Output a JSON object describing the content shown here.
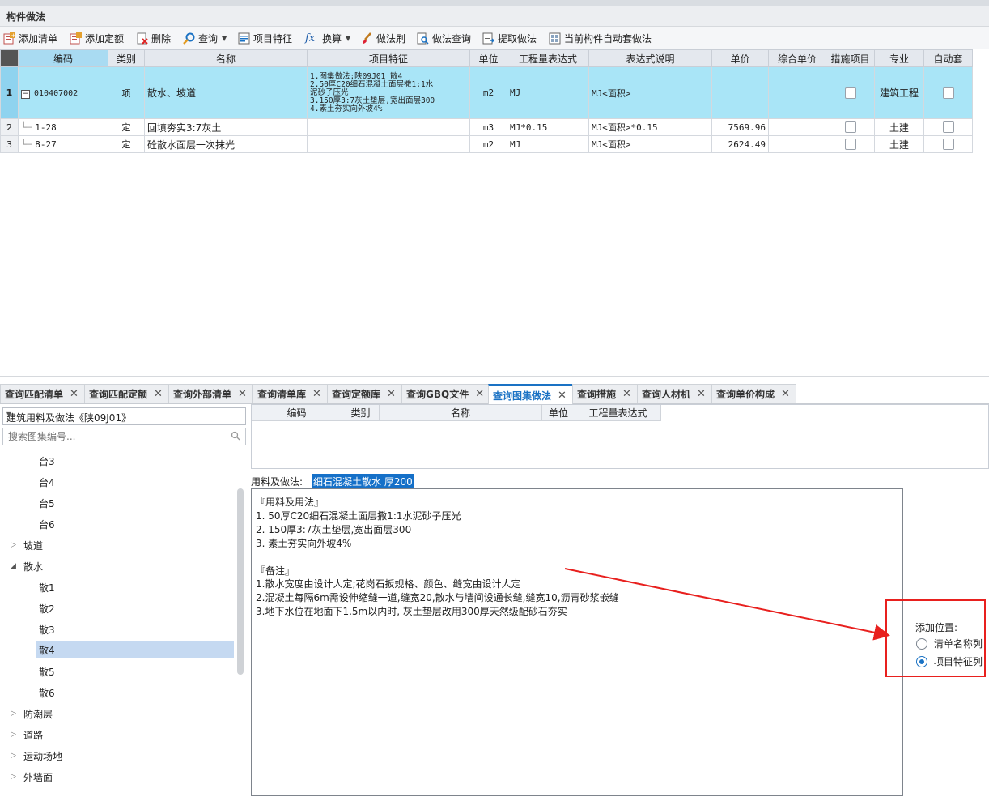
{
  "panel_title": "构件做法",
  "toolbar": {
    "add_list": "添加清单",
    "add_quota": "添加定额",
    "delete": "删除",
    "query": "查询",
    "item_feature": "项目特征",
    "convert": "换算",
    "method_brush": "做法刷",
    "method_query": "做法查询",
    "extract_method": "提取做法",
    "auto_apply": "当前构件自动套做法"
  },
  "grid": {
    "headers": [
      "编码",
      "类别",
      "名称",
      "项目特征",
      "单位",
      "工程量表达式",
      "表达式说明",
      "单价",
      "综合单价",
      "措施项目",
      "专业",
      "自动套"
    ],
    "rows": [
      {
        "num": "1",
        "tree": "−",
        "code": "010407002",
        "type": "项",
        "name": "散水、坡道",
        "feature": [
          "1.图集做法:陕09J01 散4",
          "2.50厚C20细石混凝土面层撒1:1水",
          "泥砂子压光",
          "3.150厚3:7灰土垫层,宽出面层300",
          "4.素土夯实向外坡4%"
        ],
        "unit": "m2",
        "expr": "MJ",
        "expr_desc": "MJ<面积>",
        "price": "",
        "comp_price": "",
        "measure": false,
        "specialty": "建筑工程",
        "auto": false
      },
      {
        "num": "2",
        "tree": "",
        "code": "1-28",
        "type": "定",
        "name": "回填夯实3:7灰土",
        "feature": [],
        "unit": "m3",
        "expr": "MJ*0.15",
        "expr_desc": "MJ<面积>*0.15",
        "price": "7569.96",
        "comp_price": "",
        "measure": false,
        "specialty": "土建",
        "auto": false
      },
      {
        "num": "3",
        "tree": "",
        "code": "8-27",
        "type": "定",
        "name": "砼散水面层一次抹光",
        "feature": [],
        "unit": "m2",
        "expr": "MJ",
        "expr_desc": "MJ<面积>",
        "price": "2624.49",
        "comp_price": "",
        "measure": false,
        "specialty": "土建",
        "auto": false
      }
    ]
  },
  "tabs": [
    "查询匹配清单",
    "查询匹配定额",
    "查询外部清单",
    "查询清单库",
    "查询定额库",
    "查询GBQ文件",
    "查询图集做法",
    "查询措施",
    "查询人材机",
    "查询单价构成"
  ],
  "active_tab": "查询图集做法",
  "left": {
    "combo_value": "建筑用料及做法《陕09J01》",
    "search_placeholder": "搜索图集编号...",
    "tree": [
      {
        "label": "台3",
        "level": 2,
        "arrow": ""
      },
      {
        "label": "台4",
        "level": 2,
        "arrow": ""
      },
      {
        "label": "台5",
        "level": 2,
        "arrow": ""
      },
      {
        "label": "台6",
        "level": 2,
        "arrow": ""
      },
      {
        "label": "坡道",
        "level": 1,
        "arrow": "▷"
      },
      {
        "label": "散水",
        "level": 1,
        "arrow": "◢"
      },
      {
        "label": "散1",
        "level": 2,
        "arrow": ""
      },
      {
        "label": "散2",
        "level": 2,
        "arrow": ""
      },
      {
        "label": "散3",
        "level": 2,
        "arrow": ""
      },
      {
        "label": "散4",
        "level": 2,
        "arrow": "",
        "selected": true
      },
      {
        "label": "散5",
        "level": 2,
        "arrow": ""
      },
      {
        "label": "散6",
        "level": 2,
        "arrow": ""
      },
      {
        "label": "防潮层",
        "level": 1,
        "arrow": "▷"
      },
      {
        "label": "道路",
        "level": 1,
        "arrow": "▷"
      },
      {
        "label": "运动场地",
        "level": 1,
        "arrow": "▷"
      },
      {
        "label": "外墙面",
        "level": 1,
        "arrow": "▷"
      }
    ]
  },
  "query_table": {
    "headers": [
      "编码",
      "类别",
      "名称",
      "单位",
      "工程量表达式"
    ]
  },
  "method": {
    "label": "用料及做法:",
    "value": "细石混凝土散水 厚200",
    "lines": [
      "『用料及用法』",
      "1. 50厚C20细石混凝土面层撒1:1水泥砂子压光",
      "2. 150厚3:7灰土垫层,宽出面层300",
      "3. 素土夯实向外坡4%",
      "",
      "『备注』",
      "1.散水宽度由设计人定;花岗石扳规格、颜色、缝宽由设计人定",
      "2.混凝土每隔6m需设伸缩缝一道,缝宽20,散水与墙间设通长缝,缝宽10,沥青砂浆嵌缝",
      "3.地下水位在地面下1.5m以内时, 灰土垫层改用300厚天然级配砂石夯实"
    ]
  },
  "add_position": {
    "label": "添加位置:",
    "options": [
      "清单名称列",
      "项目特征列"
    ],
    "selected": "项目特征列"
  },
  "colors": {
    "accent": "#1a72c4",
    "selected_row": "#a9e5f7",
    "highlight_box": "#e8201e"
  }
}
